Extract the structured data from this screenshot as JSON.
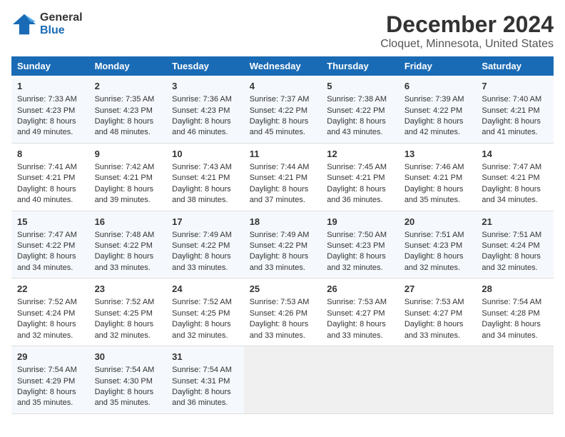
{
  "header": {
    "logo_line1": "General",
    "logo_line2": "Blue",
    "title": "December 2024",
    "subtitle": "Cloquet, Minnesota, United States"
  },
  "days_of_week": [
    "Sunday",
    "Monday",
    "Tuesday",
    "Wednesday",
    "Thursday",
    "Friday",
    "Saturday"
  ],
  "weeks": [
    [
      {
        "day": "1",
        "sunrise": "Sunrise: 7:33 AM",
        "sunset": "Sunset: 4:23 PM",
        "daylight": "Daylight: 8 hours and 49 minutes."
      },
      {
        "day": "2",
        "sunrise": "Sunrise: 7:35 AM",
        "sunset": "Sunset: 4:23 PM",
        "daylight": "Daylight: 8 hours and 48 minutes."
      },
      {
        "day": "3",
        "sunrise": "Sunrise: 7:36 AM",
        "sunset": "Sunset: 4:23 PM",
        "daylight": "Daylight: 8 hours and 46 minutes."
      },
      {
        "day": "4",
        "sunrise": "Sunrise: 7:37 AM",
        "sunset": "Sunset: 4:22 PM",
        "daylight": "Daylight: 8 hours and 45 minutes."
      },
      {
        "day": "5",
        "sunrise": "Sunrise: 7:38 AM",
        "sunset": "Sunset: 4:22 PM",
        "daylight": "Daylight: 8 hours and 43 minutes."
      },
      {
        "day": "6",
        "sunrise": "Sunrise: 7:39 AM",
        "sunset": "Sunset: 4:22 PM",
        "daylight": "Daylight: 8 hours and 42 minutes."
      },
      {
        "day": "7",
        "sunrise": "Sunrise: 7:40 AM",
        "sunset": "Sunset: 4:21 PM",
        "daylight": "Daylight: 8 hours and 41 minutes."
      }
    ],
    [
      {
        "day": "8",
        "sunrise": "Sunrise: 7:41 AM",
        "sunset": "Sunset: 4:21 PM",
        "daylight": "Daylight: 8 hours and 40 minutes."
      },
      {
        "day": "9",
        "sunrise": "Sunrise: 7:42 AM",
        "sunset": "Sunset: 4:21 PM",
        "daylight": "Daylight: 8 hours and 39 minutes."
      },
      {
        "day": "10",
        "sunrise": "Sunrise: 7:43 AM",
        "sunset": "Sunset: 4:21 PM",
        "daylight": "Daylight: 8 hours and 38 minutes."
      },
      {
        "day": "11",
        "sunrise": "Sunrise: 7:44 AM",
        "sunset": "Sunset: 4:21 PM",
        "daylight": "Daylight: 8 hours and 37 minutes."
      },
      {
        "day": "12",
        "sunrise": "Sunrise: 7:45 AM",
        "sunset": "Sunset: 4:21 PM",
        "daylight": "Daylight: 8 hours and 36 minutes."
      },
      {
        "day": "13",
        "sunrise": "Sunrise: 7:46 AM",
        "sunset": "Sunset: 4:21 PM",
        "daylight": "Daylight: 8 hours and 35 minutes."
      },
      {
        "day": "14",
        "sunrise": "Sunrise: 7:47 AM",
        "sunset": "Sunset: 4:21 PM",
        "daylight": "Daylight: 8 hours and 34 minutes."
      }
    ],
    [
      {
        "day": "15",
        "sunrise": "Sunrise: 7:47 AM",
        "sunset": "Sunset: 4:22 PM",
        "daylight": "Daylight: 8 hours and 34 minutes."
      },
      {
        "day": "16",
        "sunrise": "Sunrise: 7:48 AM",
        "sunset": "Sunset: 4:22 PM",
        "daylight": "Daylight: 8 hours and 33 minutes."
      },
      {
        "day": "17",
        "sunrise": "Sunrise: 7:49 AM",
        "sunset": "Sunset: 4:22 PM",
        "daylight": "Daylight: 8 hours and 33 minutes."
      },
      {
        "day": "18",
        "sunrise": "Sunrise: 7:49 AM",
        "sunset": "Sunset: 4:22 PM",
        "daylight": "Daylight: 8 hours and 33 minutes."
      },
      {
        "day": "19",
        "sunrise": "Sunrise: 7:50 AM",
        "sunset": "Sunset: 4:23 PM",
        "daylight": "Daylight: 8 hours and 32 minutes."
      },
      {
        "day": "20",
        "sunrise": "Sunrise: 7:51 AM",
        "sunset": "Sunset: 4:23 PM",
        "daylight": "Daylight: 8 hours and 32 minutes."
      },
      {
        "day": "21",
        "sunrise": "Sunrise: 7:51 AM",
        "sunset": "Sunset: 4:24 PM",
        "daylight": "Daylight: 8 hours and 32 minutes."
      }
    ],
    [
      {
        "day": "22",
        "sunrise": "Sunrise: 7:52 AM",
        "sunset": "Sunset: 4:24 PM",
        "daylight": "Daylight: 8 hours and 32 minutes."
      },
      {
        "day": "23",
        "sunrise": "Sunrise: 7:52 AM",
        "sunset": "Sunset: 4:25 PM",
        "daylight": "Daylight: 8 hours and 32 minutes."
      },
      {
        "day": "24",
        "sunrise": "Sunrise: 7:52 AM",
        "sunset": "Sunset: 4:25 PM",
        "daylight": "Daylight: 8 hours and 32 minutes."
      },
      {
        "day": "25",
        "sunrise": "Sunrise: 7:53 AM",
        "sunset": "Sunset: 4:26 PM",
        "daylight": "Daylight: 8 hours and 33 minutes."
      },
      {
        "day": "26",
        "sunrise": "Sunrise: 7:53 AM",
        "sunset": "Sunset: 4:27 PM",
        "daylight": "Daylight: 8 hours and 33 minutes."
      },
      {
        "day": "27",
        "sunrise": "Sunrise: 7:53 AM",
        "sunset": "Sunset: 4:27 PM",
        "daylight": "Daylight: 8 hours and 33 minutes."
      },
      {
        "day": "28",
        "sunrise": "Sunrise: 7:54 AM",
        "sunset": "Sunset: 4:28 PM",
        "daylight": "Daylight: 8 hours and 34 minutes."
      }
    ],
    [
      {
        "day": "29",
        "sunrise": "Sunrise: 7:54 AM",
        "sunset": "Sunset: 4:29 PM",
        "daylight": "Daylight: 8 hours and 35 minutes."
      },
      {
        "day": "30",
        "sunrise": "Sunrise: 7:54 AM",
        "sunset": "Sunset: 4:30 PM",
        "daylight": "Daylight: 8 hours and 35 minutes."
      },
      {
        "day": "31",
        "sunrise": "Sunrise: 7:54 AM",
        "sunset": "Sunset: 4:31 PM",
        "daylight": "Daylight: 8 hours and 36 minutes."
      },
      null,
      null,
      null,
      null
    ]
  ]
}
